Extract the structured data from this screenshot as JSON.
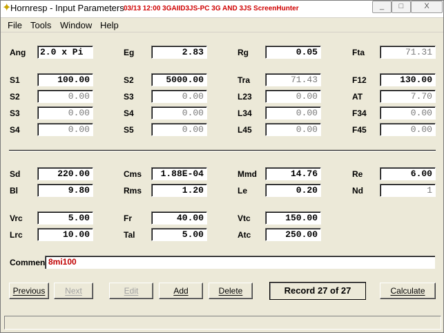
{
  "window": {
    "title": "Hornresp - Input Parameters",
    "overlay": "03/13 12:00 3GAIID3JS-PC 3G AND 3JS ScreenHunter",
    "minimize_glyph": "_",
    "maximize_glyph": "□",
    "close_glyph": "X"
  },
  "menu": [
    "File",
    "Tools",
    "Window",
    "Help"
  ],
  "fields": {
    "ang": {
      "label": "Ang",
      "value": "2.0 x Pi"
    },
    "eg": {
      "label": "Eg",
      "value": "2.83"
    },
    "rg": {
      "label": "Rg",
      "value": "0.05"
    },
    "fta": {
      "label": "Fta",
      "value": "71.31"
    },
    "s1": {
      "label": "S1",
      "value": "100.00"
    },
    "s2a": {
      "label": "S2",
      "value": "5000.00"
    },
    "tra": {
      "label": "Tra",
      "value": "71.43"
    },
    "f12": {
      "label": "F12",
      "value": "130.00"
    },
    "s2b": {
      "label": "S2",
      "value": "0.00"
    },
    "s3a": {
      "label": "S3",
      "value": "0.00"
    },
    "l23": {
      "label": "L23",
      "value": "0.00"
    },
    "at": {
      "label": "AT",
      "value": "7.70"
    },
    "s3b": {
      "label": "S3",
      "value": "0.00"
    },
    "s4a": {
      "label": "S4",
      "value": "0.00"
    },
    "l34": {
      "label": "L34",
      "value": "0.00"
    },
    "f34": {
      "label": "F34",
      "value": "0.00"
    },
    "s4b": {
      "label": "S4",
      "value": "0.00"
    },
    "s5": {
      "label": "S5",
      "value": "0.00"
    },
    "l45": {
      "label": "L45",
      "value": "0.00"
    },
    "f45": {
      "label": "F45",
      "value": "0.00"
    },
    "sd": {
      "label": "Sd",
      "value": "220.00"
    },
    "cms": {
      "label": "Cms",
      "value": "1.88E-04"
    },
    "mmd": {
      "label": "Mmd",
      "value": "14.76"
    },
    "re": {
      "label": "Re",
      "value": "6.00"
    },
    "bl": {
      "label": "Bl",
      "value": "9.80"
    },
    "rms": {
      "label": "Rms",
      "value": "1.20"
    },
    "le": {
      "label": "Le",
      "value": "0.20"
    },
    "nd": {
      "label": "Nd",
      "value": "1"
    },
    "vrc": {
      "label": "Vrc",
      "value": "5.00"
    },
    "fr": {
      "label": "Fr",
      "value": "40.00"
    },
    "vtc": {
      "label": "Vtc",
      "value": "150.00"
    },
    "lrc": {
      "label": "Lrc",
      "value": "10.00"
    },
    "tal": {
      "label": "Tal",
      "value": "5.00"
    },
    "atc": {
      "label": "Atc",
      "value": "250.00"
    }
  },
  "comment": {
    "label": "Comment",
    "value": "8mi100"
  },
  "buttons": {
    "previous": "Previous",
    "next": "Next",
    "edit": "Edit",
    "add": "Add",
    "delete": "Delete",
    "calculate": "Calculate"
  },
  "record": "Record 27 of 27",
  "colors": {
    "window_bg": "#ECE9D8",
    "overlay_text": "#d00000",
    "comment_text": "#c00000",
    "readonly_text": "#7a7a7a"
  }
}
